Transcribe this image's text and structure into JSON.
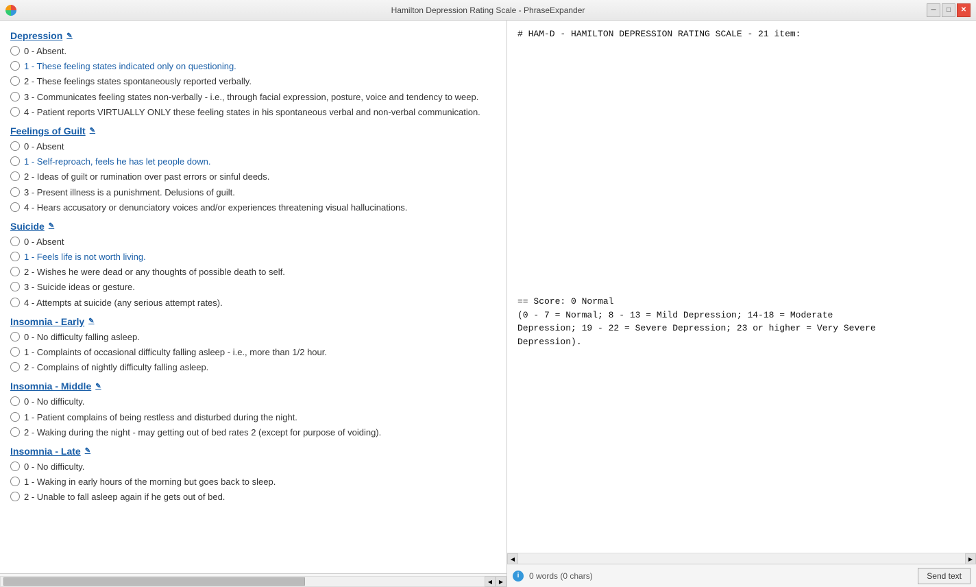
{
  "titleBar": {
    "title": "Hamilton Depression Rating Scale - PhraseExpander",
    "minimizeLabel": "─",
    "maximizeLabel": "□",
    "closeLabel": "✕"
  },
  "sections": [
    {
      "id": "depression",
      "label": "Depression",
      "options": [
        {
          "value": "0",
          "text": "0 - Absent."
        },
        {
          "value": "1",
          "text": "1 - These feeling states indicated only on questioning.",
          "blue": true
        },
        {
          "value": "2",
          "text": "2 - These feelings states spontaneously reported verbally."
        },
        {
          "value": "3",
          "text": "3 - Communicates feeling states non-verbally - i.e., through facial expression, posture, voice and tendency to weep."
        },
        {
          "value": "4",
          "text": "4 - Patient reports VIRTUALLY ONLY these feeling states in his spontaneous verbal and non-verbal communication."
        }
      ]
    },
    {
      "id": "feelings-of-guilt",
      "label": "Feelings of Guilt",
      "options": [
        {
          "value": "0",
          "text": "0 - Absent"
        },
        {
          "value": "1",
          "text": "1 - Self-reproach, feels he has let people down.",
          "blue": true
        },
        {
          "value": "2",
          "text": "2 - Ideas of guilt or rumination over past errors or sinful deeds."
        },
        {
          "value": "3",
          "text": "3 - Present illness is a punishment. Delusions of guilt."
        },
        {
          "value": "4",
          "text": "4 - Hears accusatory or denunciatory voices and/or experiences threatening visual hallucinations."
        }
      ]
    },
    {
      "id": "suicide",
      "label": "Suicide",
      "options": [
        {
          "value": "0",
          "text": "0 - Absent"
        },
        {
          "value": "1",
          "text": "1 - Feels life is not worth living.",
          "blue": true
        },
        {
          "value": "2",
          "text": "2 - Wishes he were dead or any thoughts of possible death to self."
        },
        {
          "value": "3",
          "text": "3 - Suicide ideas or gesture."
        },
        {
          "value": "4",
          "text": "4 - Attempts at suicide (any serious attempt rates)."
        }
      ]
    },
    {
      "id": "insomnia-early",
      "label": "Insomnia - Early",
      "options": [
        {
          "value": "0",
          "text": "0 - No difficulty falling asleep."
        },
        {
          "value": "1",
          "text": "1 - Complaints of occasional difficulty falling asleep - i.e., more than 1/2 hour."
        },
        {
          "value": "2",
          "text": "2 - Complains of nightly difficulty falling asleep."
        }
      ]
    },
    {
      "id": "insomnia-middle",
      "label": "Insomnia - Middle",
      "options": [
        {
          "value": "0",
          "text": "0 - No difficulty."
        },
        {
          "value": "1",
          "text": "1 - Patient complains of being restless and disturbed during the night."
        },
        {
          "value": "2",
          "text": "2 - Waking during the night - may getting out of bed rates 2 (except for purpose of voiding)."
        }
      ]
    },
    {
      "id": "insomnia-late",
      "label": "Insomnia - Late",
      "options": [
        {
          "value": "0",
          "text": "0 - No difficulty."
        },
        {
          "value": "1",
          "text": "1 - Waking in early hours of the morning but goes back to sleep."
        },
        {
          "value": "2",
          "text": "2 - Unable to fall asleep again if he gets out of bed."
        }
      ]
    }
  ],
  "rightPanel": {
    "content": "# HAM-D - HAMILTON DEPRESSION RATING SCALE - 21 item:\n\n\n\n\n\n\n\n\n\n\n\n\n\n\n\n\n\n\n\n== Score: 0 Normal\n(0 - 7 = Normal; 8 - 13 = Mild Depression; 14-18 = Moderate\nDepression; 19 - 22 = Severe Depression; 23 or higher = Very Severe\nDepression)."
  },
  "statusBar": {
    "wordCount": "0 words (0 chars)",
    "sendTextLabel": "Send text"
  }
}
